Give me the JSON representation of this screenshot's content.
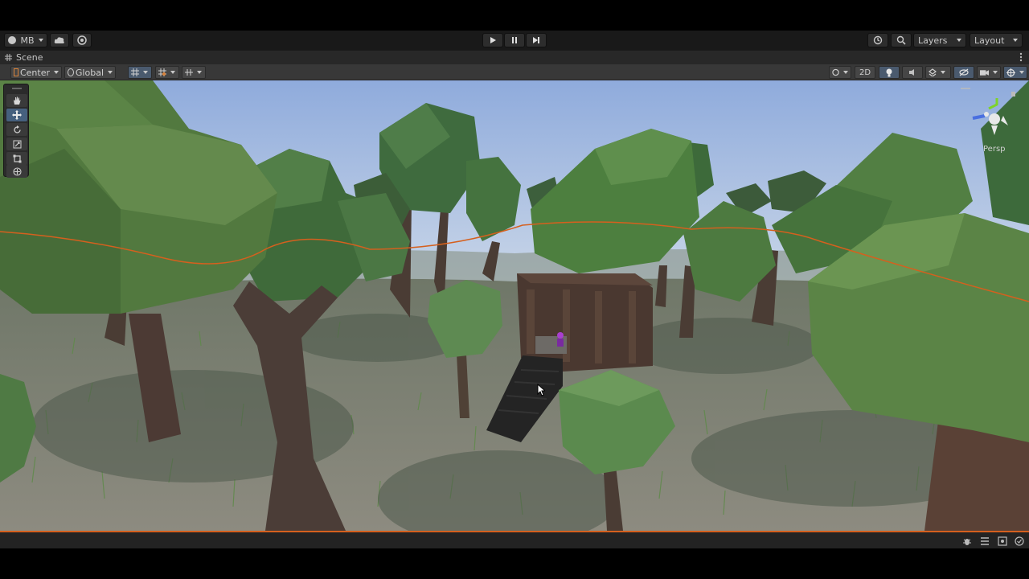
{
  "topbar": {
    "account": "MB",
    "layers_label": "Layers",
    "layout_label": "Layout",
    "icons": [
      "account-icon",
      "cloud-icon",
      "collab-icon",
      "play-icon",
      "pause-icon",
      "step-icon",
      "history-icon",
      "search-icon"
    ]
  },
  "scene_tab": {
    "label": "Scene"
  },
  "scene_toolbar": {
    "pivot_label": "Center",
    "space_label": "Global",
    "mode_2d": "2D",
    "icons": [
      "grid-snap-icon",
      "snap-increment-icon",
      "grid-icon",
      "shading-icon",
      "lighting-icon",
      "audio-icon",
      "effects-icon",
      "hidden-objects-icon",
      "camera-icon",
      "gizmos-icon"
    ]
  },
  "tools": [
    "hand-tool-icon",
    "move-tool-icon",
    "rotate-tool-icon",
    "scale-tool-icon",
    "rect-tool-icon",
    "transform-tool-icon"
  ],
  "gizmo": {
    "label": "Persp"
  },
  "statusbar": {
    "icons": [
      "bug-icon",
      "network-icon",
      "cache-icon",
      "check-icon"
    ]
  },
  "colors": {
    "accent_orange": "#d5601e",
    "sky_top": "#9db7e3",
    "leaf_green": "#5b7f3f",
    "ground": "#8a8678"
  }
}
